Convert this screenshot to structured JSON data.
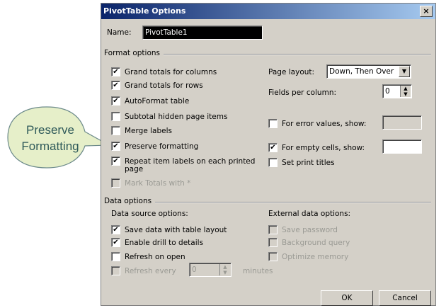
{
  "callout": {
    "text": "Preserve Formatting",
    "fill": "#e6efc9",
    "stroke": "#6c8a8a"
  },
  "dialog": {
    "title": "PivotTable Options",
    "close_symbol": "×",
    "name_label": "Name:",
    "name_value": "PivotTable1",
    "format_section": "Format options",
    "format_checks": [
      {
        "label": "Grand totals for columns",
        "checked": true
      },
      {
        "label": "Grand totals for rows",
        "checked": true
      },
      {
        "label": "AutoFormat table",
        "checked": true
      },
      {
        "label": "Subtotal hidden page items",
        "checked": false
      },
      {
        "label": "Merge labels",
        "checked": false
      },
      {
        "label": "Preserve formatting",
        "checked": true
      },
      {
        "label": "Repeat item labels on each printed",
        "label2": "page",
        "checked": true
      },
      {
        "label": "Mark Totals with *",
        "checked": false,
        "disabled": true
      }
    ],
    "page_layout_label": "Page layout:",
    "page_layout_value": "Down, Then Over",
    "fields_per_column_label": "Fields per column:",
    "fields_per_column_value": "0",
    "error_values_label": "For error values, show:",
    "error_values_checked": false,
    "empty_cells_label": "For empty cells, show:",
    "empty_cells_checked": true,
    "print_titles_label": "Set print titles",
    "print_titles_checked": false,
    "data_section": "Data options",
    "data_source_heading": "Data source options:",
    "data_source_checks": [
      {
        "label": "Save data with table layout",
        "checked": true
      },
      {
        "label": "Enable drill to details",
        "checked": true
      },
      {
        "label": "Refresh on open",
        "checked": false
      }
    ],
    "refresh_every_label": "Refresh every",
    "refresh_every_value": "0",
    "minutes_label": "minutes",
    "external_heading": "External data options:",
    "external_checks": [
      {
        "label": "Save password",
        "checked": false
      },
      {
        "label": "Background query",
        "checked": false
      },
      {
        "label": "Optimize memory",
        "checked": false
      }
    ],
    "ok_label": "OK",
    "cancel_label": "Cancel",
    "check_mark": "✔"
  }
}
